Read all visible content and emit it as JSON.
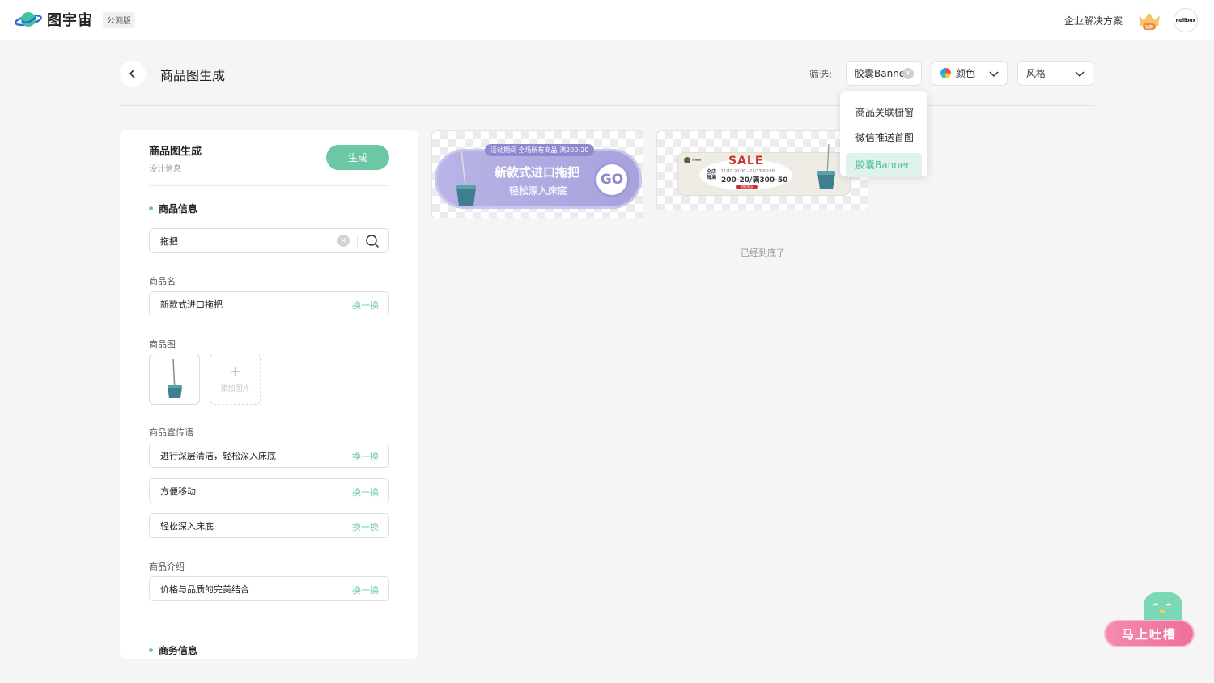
{
  "topbar": {
    "logo_title": "图宇宙",
    "logo_badge": "公测版",
    "enterprise_link": "企业解决方案",
    "vip_label": "VIP",
    "avatar_text": "nollbox"
  },
  "page": {
    "title": "商品图生成",
    "filter_label": "筛选:",
    "filters": {
      "type_value": "胶囊Banner",
      "color_label": "颜色",
      "style_label": "风格"
    },
    "dropdown_options": [
      "商品关联橱窗",
      "微信推送首图",
      "胶囊Banner"
    ],
    "dropdown_selected": "胶囊Banner"
  },
  "panel": {
    "title": "商品图生成",
    "subtitle": "设计信息",
    "generate_button": "生成",
    "section_product": "商品信息",
    "search_value": "拖把",
    "name_label": "商品名",
    "name_value": "新款式进口拖把",
    "swap_label": "换一换",
    "image_label": "商品图",
    "add_image_label": "添加图片",
    "slogan_label": "商品宣传语",
    "slogans": [
      "进行深层清洁，轻松深入床底",
      "方便移动",
      "轻松深入床底"
    ],
    "intro_label": "商品介绍",
    "intro_value": "价格与品质的完美结合",
    "section_business": "商务信息"
  },
  "results": {
    "banner1": {
      "tag": "活动期间 全场所有商品 满200-20",
      "title": "新款式进口拖把",
      "subtitle": "轻松深入床底",
      "cta": "GO"
    },
    "banner2": {
      "sale": "SALE",
      "dates": "11/10 20:00 - 11/13 00:00",
      "deal": "200-20/满300-50",
      "left_text": "全店每满",
      "button": "前往购买"
    },
    "end_text": "已经到底了"
  },
  "feedback": {
    "label": "马上吐槽"
  },
  "colors": {
    "accent": "#6cc7a5",
    "banner_purple": "#a7a2dc",
    "sale_red": "#c9332f",
    "feedback_pink": "#ee6f9c"
  }
}
